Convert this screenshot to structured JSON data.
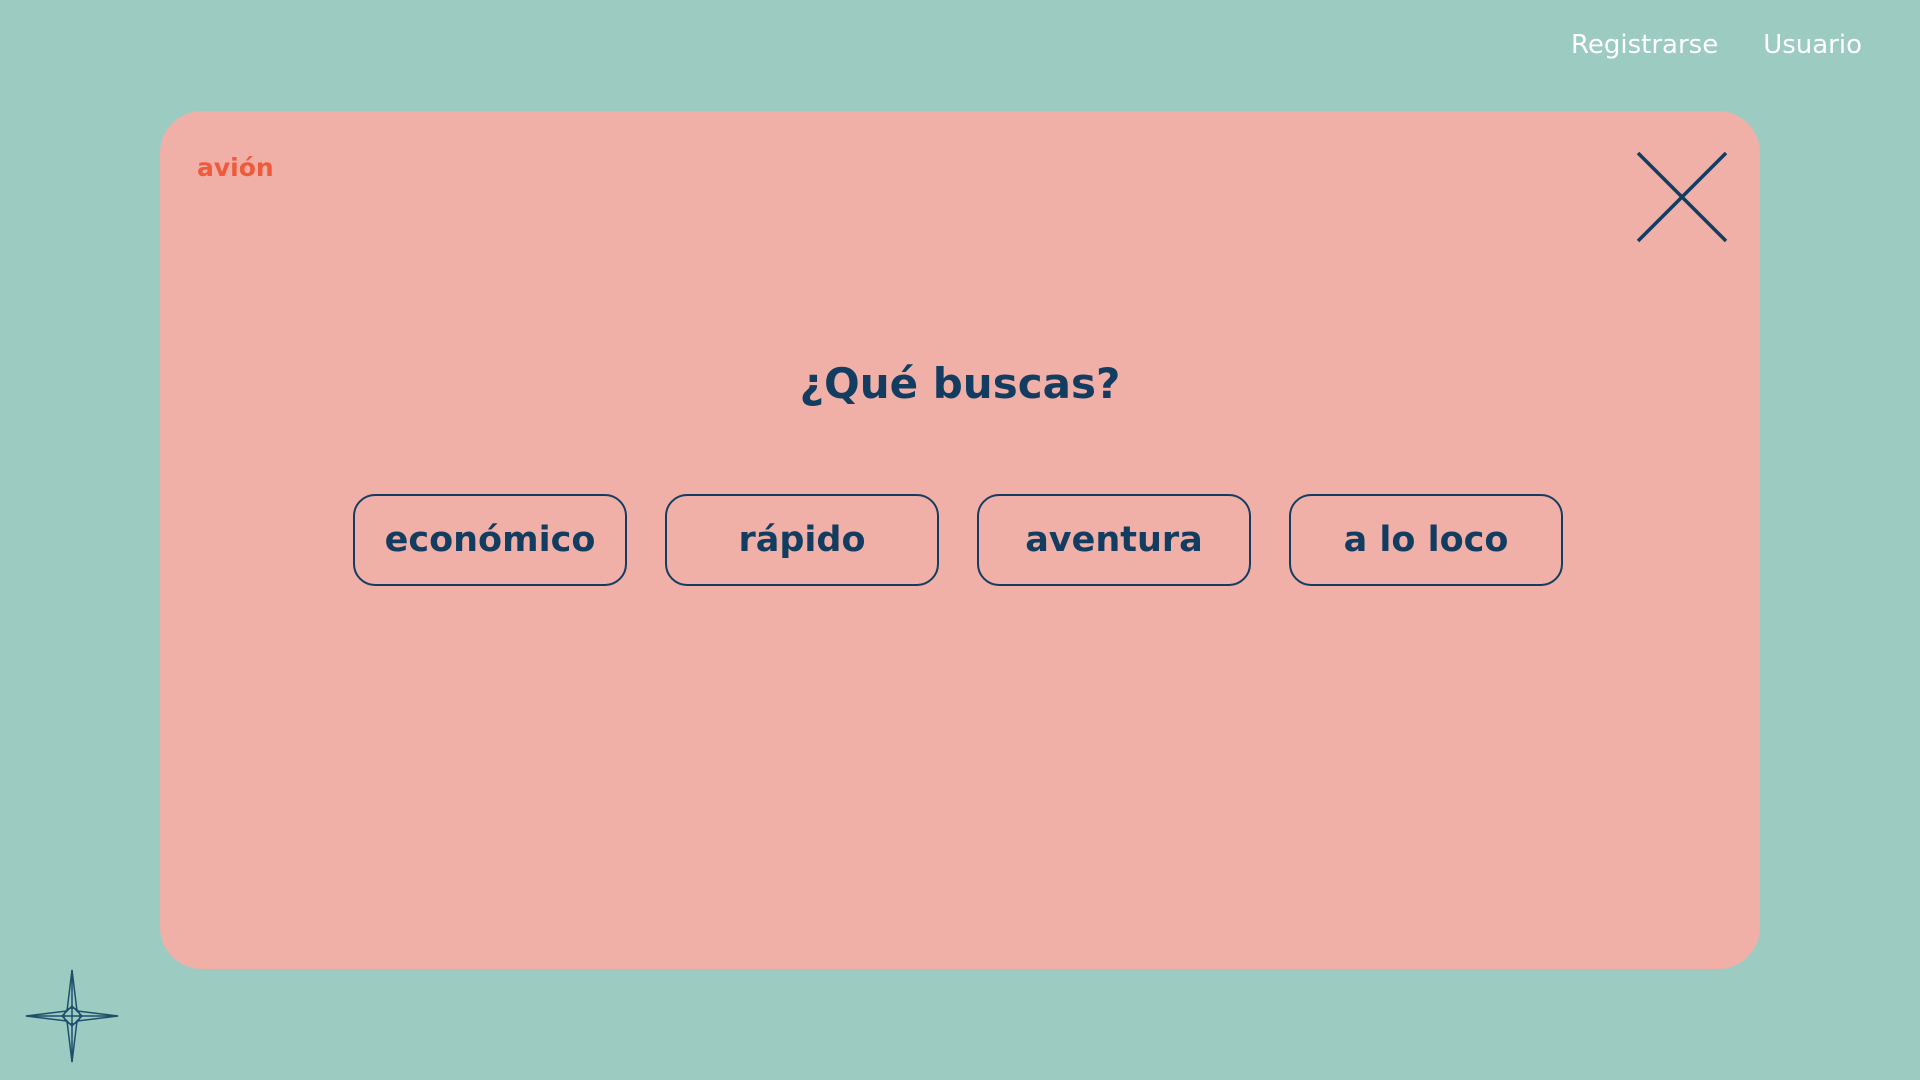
{
  "nav": {
    "register": "Registrarse",
    "user": "Usuario"
  },
  "modal": {
    "brand": "avión",
    "title": "¿Qué buscas?",
    "close_icon": "close-icon",
    "options": [
      "económico",
      "rápido",
      "aventura",
      "a lo loco"
    ]
  },
  "decor": {
    "corner_icon": "compass-star-icon"
  },
  "colors": {
    "background": "#9ccbc1",
    "modal_background": "#f0b0a8",
    "brand_accent": "#ef5a3b",
    "primary_text": "#123d61",
    "nav_text": "#ffffff"
  }
}
